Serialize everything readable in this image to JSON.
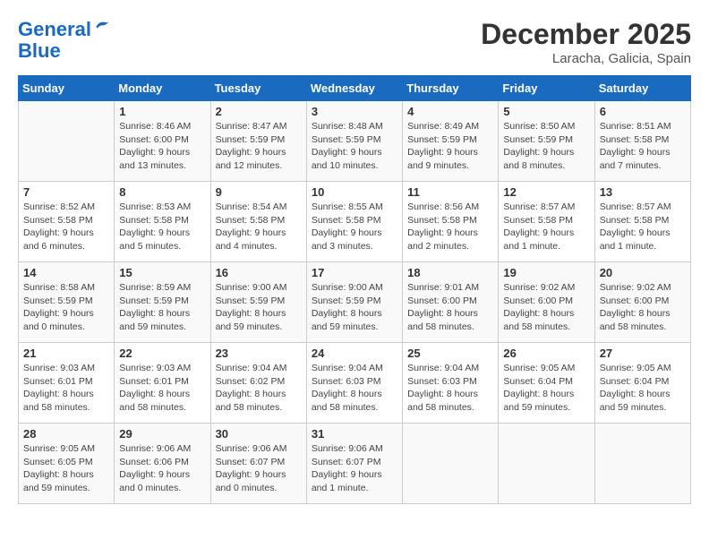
{
  "header": {
    "logo_line1": "General",
    "logo_line2": "Blue",
    "month_title": "December 2025",
    "location": "Laracha, Galicia, Spain"
  },
  "days_of_week": [
    "Sunday",
    "Monday",
    "Tuesday",
    "Wednesday",
    "Thursday",
    "Friday",
    "Saturday"
  ],
  "weeks": [
    [
      {
        "day": "",
        "info": ""
      },
      {
        "day": "1",
        "info": "Sunrise: 8:46 AM\nSunset: 6:00 PM\nDaylight: 9 hours\nand 13 minutes."
      },
      {
        "day": "2",
        "info": "Sunrise: 8:47 AM\nSunset: 5:59 PM\nDaylight: 9 hours\nand 12 minutes."
      },
      {
        "day": "3",
        "info": "Sunrise: 8:48 AM\nSunset: 5:59 PM\nDaylight: 9 hours\nand 10 minutes."
      },
      {
        "day": "4",
        "info": "Sunrise: 8:49 AM\nSunset: 5:59 PM\nDaylight: 9 hours\nand 9 minutes."
      },
      {
        "day": "5",
        "info": "Sunrise: 8:50 AM\nSunset: 5:59 PM\nDaylight: 9 hours\nand 8 minutes."
      },
      {
        "day": "6",
        "info": "Sunrise: 8:51 AM\nSunset: 5:58 PM\nDaylight: 9 hours\nand 7 minutes."
      }
    ],
    [
      {
        "day": "7",
        "info": "Sunrise: 8:52 AM\nSunset: 5:58 PM\nDaylight: 9 hours\nand 6 minutes."
      },
      {
        "day": "8",
        "info": "Sunrise: 8:53 AM\nSunset: 5:58 PM\nDaylight: 9 hours\nand 5 minutes."
      },
      {
        "day": "9",
        "info": "Sunrise: 8:54 AM\nSunset: 5:58 PM\nDaylight: 9 hours\nand 4 minutes."
      },
      {
        "day": "10",
        "info": "Sunrise: 8:55 AM\nSunset: 5:58 PM\nDaylight: 9 hours\nand 3 minutes."
      },
      {
        "day": "11",
        "info": "Sunrise: 8:56 AM\nSunset: 5:58 PM\nDaylight: 9 hours\nand 2 minutes."
      },
      {
        "day": "12",
        "info": "Sunrise: 8:57 AM\nSunset: 5:58 PM\nDaylight: 9 hours\nand 1 minute."
      },
      {
        "day": "13",
        "info": "Sunrise: 8:57 AM\nSunset: 5:58 PM\nDaylight: 9 hours\nand 1 minute."
      }
    ],
    [
      {
        "day": "14",
        "info": "Sunrise: 8:58 AM\nSunset: 5:59 PM\nDaylight: 9 hours\nand 0 minutes."
      },
      {
        "day": "15",
        "info": "Sunrise: 8:59 AM\nSunset: 5:59 PM\nDaylight: 8 hours\nand 59 minutes."
      },
      {
        "day": "16",
        "info": "Sunrise: 9:00 AM\nSunset: 5:59 PM\nDaylight: 8 hours\nand 59 minutes."
      },
      {
        "day": "17",
        "info": "Sunrise: 9:00 AM\nSunset: 5:59 PM\nDaylight: 8 hours\nand 59 minutes."
      },
      {
        "day": "18",
        "info": "Sunrise: 9:01 AM\nSunset: 6:00 PM\nDaylight: 8 hours\nand 58 minutes."
      },
      {
        "day": "19",
        "info": "Sunrise: 9:02 AM\nSunset: 6:00 PM\nDaylight: 8 hours\nand 58 minutes."
      },
      {
        "day": "20",
        "info": "Sunrise: 9:02 AM\nSunset: 6:00 PM\nDaylight: 8 hours\nand 58 minutes."
      }
    ],
    [
      {
        "day": "21",
        "info": "Sunrise: 9:03 AM\nSunset: 6:01 PM\nDaylight: 8 hours\nand 58 minutes."
      },
      {
        "day": "22",
        "info": "Sunrise: 9:03 AM\nSunset: 6:01 PM\nDaylight: 8 hours\nand 58 minutes."
      },
      {
        "day": "23",
        "info": "Sunrise: 9:04 AM\nSunset: 6:02 PM\nDaylight: 8 hours\nand 58 minutes."
      },
      {
        "day": "24",
        "info": "Sunrise: 9:04 AM\nSunset: 6:03 PM\nDaylight: 8 hours\nand 58 minutes."
      },
      {
        "day": "25",
        "info": "Sunrise: 9:04 AM\nSunset: 6:03 PM\nDaylight: 8 hours\nand 58 minutes."
      },
      {
        "day": "26",
        "info": "Sunrise: 9:05 AM\nSunset: 6:04 PM\nDaylight: 8 hours\nand 59 minutes."
      },
      {
        "day": "27",
        "info": "Sunrise: 9:05 AM\nSunset: 6:04 PM\nDaylight: 8 hours\nand 59 minutes."
      }
    ],
    [
      {
        "day": "28",
        "info": "Sunrise: 9:05 AM\nSunset: 6:05 PM\nDaylight: 8 hours\nand 59 minutes."
      },
      {
        "day": "29",
        "info": "Sunrise: 9:06 AM\nSunset: 6:06 PM\nDaylight: 9 hours\nand 0 minutes."
      },
      {
        "day": "30",
        "info": "Sunrise: 9:06 AM\nSunset: 6:07 PM\nDaylight: 9 hours\nand 0 minutes."
      },
      {
        "day": "31",
        "info": "Sunrise: 9:06 AM\nSunset: 6:07 PM\nDaylight: 9 hours\nand 1 minute."
      },
      {
        "day": "",
        "info": ""
      },
      {
        "day": "",
        "info": ""
      },
      {
        "day": "",
        "info": ""
      }
    ]
  ]
}
